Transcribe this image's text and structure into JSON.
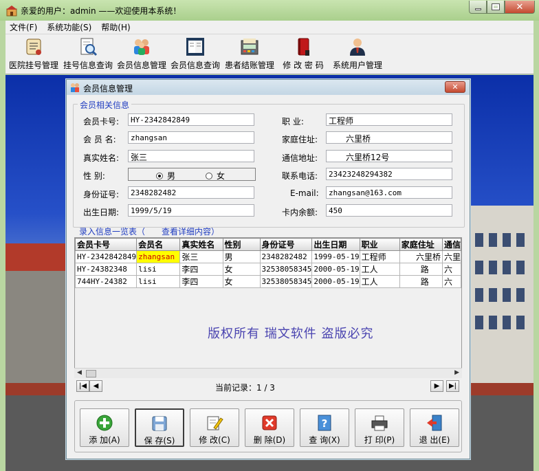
{
  "window": {
    "title": "亲爱的用户：admin ——欢迎使用本系统！"
  },
  "menu": [
    "文件(F)",
    "系统功能(S)",
    "帮助(H)"
  ],
  "toolbar": [
    {
      "label": "医院挂号管理",
      "icon": "register-scroll-icon"
    },
    {
      "label": "挂号信息查询",
      "icon": "document-search-icon"
    },
    {
      "label": "会员信息管理",
      "icon": "members-group-icon"
    },
    {
      "label": "会员信息查询",
      "icon": "open-book-icon"
    },
    {
      "label": "患者结账管理",
      "icon": "billing-machine-icon"
    },
    {
      "label": "修 改 密 码",
      "icon": "red-book-icon"
    },
    {
      "label": "系统用户管理",
      "icon": "user-admin-icon"
    }
  ],
  "dialog": {
    "title": "会员信息管理",
    "group_label": "会员相关信息",
    "fields": {
      "card_no": {
        "label": "会员卡号:",
        "value": "HY-2342842849"
      },
      "member_name": {
        "label": "会 员 名:",
        "value": "zhangsan"
      },
      "real_name": {
        "label": "真实姓名:",
        "value": "张三"
      },
      "gender": {
        "label": "性    别:",
        "options": [
          "男",
          "女"
        ],
        "selected": "男"
      },
      "id_card": {
        "label": "身份证号:",
        "value": "2348282482"
      },
      "birth_date": {
        "label": "出生日期:",
        "value": "1999/5/19"
      },
      "occupation": {
        "label": "职    业:",
        "value": "工程师"
      },
      "home_address": {
        "label": "家庭住址:",
        "value": "六里桥"
      },
      "mail_address": {
        "label": "通信地址:",
        "value": "六里桥12号"
      },
      "phone": {
        "label": "联系电话:",
        "value": "23423248294382"
      },
      "email": {
        "label": "E-mail:",
        "value": "zhangsan@163.com"
      },
      "balance": {
        "label": "卡内余额:",
        "value": "450"
      }
    },
    "list_label_left": "录入信息一览表（",
    "list_label_right": "查看详细内容）",
    "table": {
      "columns": [
        "会员卡号",
        "会员名",
        "真实姓名",
        "性别",
        "身份证号",
        "出生日期",
        "职业",
        "家庭住址",
        "通信"
      ],
      "rows": [
        [
          "HY-2342842849",
          "zhangsan",
          "张三",
          "男",
          "2348282482",
          "1999-05-19",
          "工程师",
          "六里桥",
          "六里"
        ],
        [
          "HY-24382348",
          "lisi",
          "李四",
          "女",
          "32538058345",
          "2000-05-19",
          "工人",
          "路",
          "六"
        ],
        [
          "744HY-24382",
          "lisi",
          "李四",
          "女",
          "32538058345",
          "2000-05-19",
          "工人",
          "路",
          "六"
        ]
      ]
    },
    "watermark": "版权所有  瑞文软件  盗版必究",
    "record_status": "当前记录：1 / 3",
    "buttons": [
      "添 加(A)",
      "保 存(S)",
      "修 改(C)",
      "删 除(D)",
      "查 询(X)",
      "打 印(P)",
      "退 出(E)"
    ]
  },
  "colors": {
    "titlebar": "#b5d99c",
    "legend": "#1f3cc0",
    "selected_cell": "#ffff00"
  }
}
